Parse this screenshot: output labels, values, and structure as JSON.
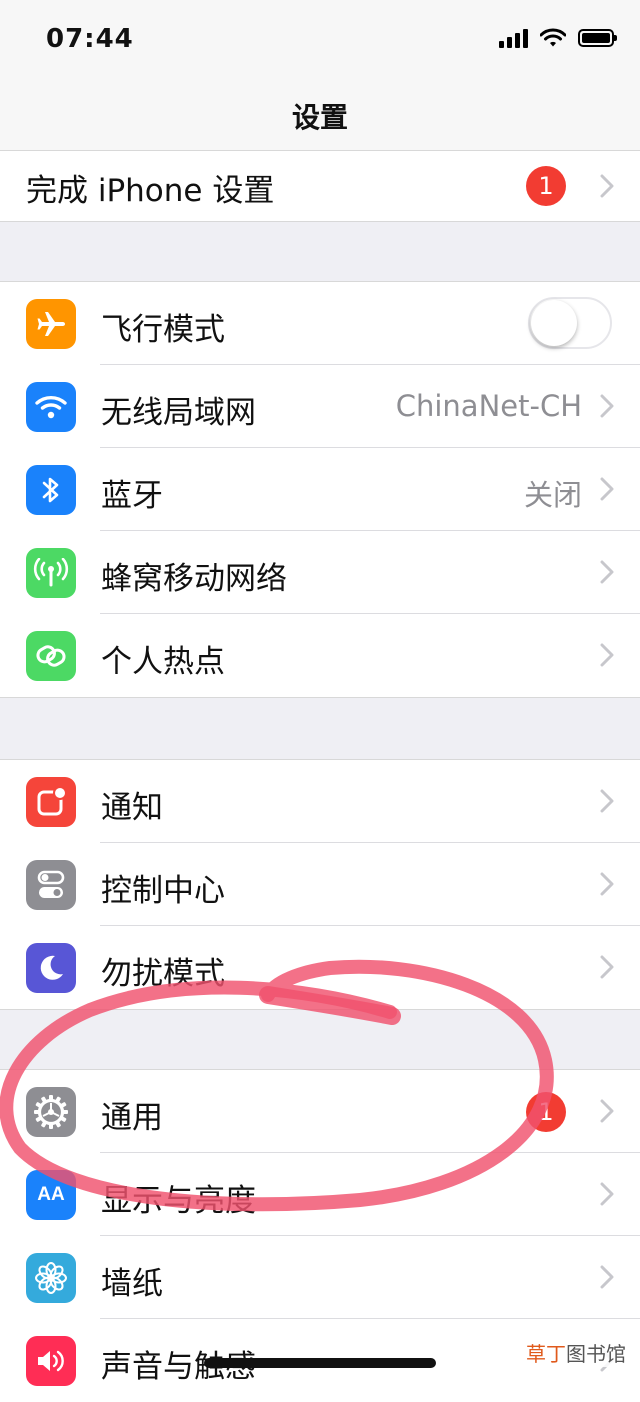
{
  "status_bar": {
    "time": "07:44"
  },
  "nav": {
    "title": "设置"
  },
  "colors": {
    "badge_red": "#f23c32",
    "airplane_orange": "#ff9500",
    "wifi_blue": "#1a82fb",
    "bluetooth_blue": "#1a82fb",
    "cellular_green": "#4cd964",
    "hotspot_green": "#4cd964",
    "notifications_red": "#f5453a",
    "control_gray": "#8e8e93",
    "dnd_purple": "#5856d6",
    "general_gray": "#8e8e93",
    "display_blue": "#1a82fb",
    "wallpaper_blue": "#34aadc",
    "sounds_pink": "#ff2d55",
    "annotation_red": "#f0526e"
  },
  "setup": {
    "label": "完成 iPhone 设置",
    "badge": "1"
  },
  "connectivity": {
    "airplane": {
      "label": "飞行模式",
      "icon": "airplane-icon",
      "toggle_on": false
    },
    "wifi": {
      "label": "无线局域网",
      "value": "ChinaNet-CH",
      "icon": "wifi-icon"
    },
    "bluetooth": {
      "label": "蓝牙",
      "value": "关闭",
      "icon": "bluetooth-icon"
    },
    "cellular": {
      "label": "蜂窝移动网络",
      "icon": "cellular-antenna-icon"
    },
    "hotspot": {
      "label": "个人热点",
      "icon": "hotspot-link-icon"
    }
  },
  "system": {
    "notifications": {
      "label": "通知",
      "icon": "notifications-icon"
    },
    "control_center": {
      "label": "控制中心",
      "icon": "control-center-icon"
    },
    "do_not_disturb": {
      "label": "勿扰模式",
      "icon": "moon-icon"
    }
  },
  "general_group": {
    "general": {
      "label": "通用",
      "badge": "1",
      "icon": "gear-icon"
    },
    "display": {
      "label": "显示与亮度",
      "icon_text": "AA",
      "icon": "text-size-icon"
    },
    "wallpaper": {
      "label": "墙纸",
      "icon": "flower-icon"
    },
    "sounds": {
      "label": "声音与触感",
      "icon": "speaker-icon"
    }
  },
  "watermark": {
    "accent": "草丁",
    "rest": "图书馆"
  }
}
